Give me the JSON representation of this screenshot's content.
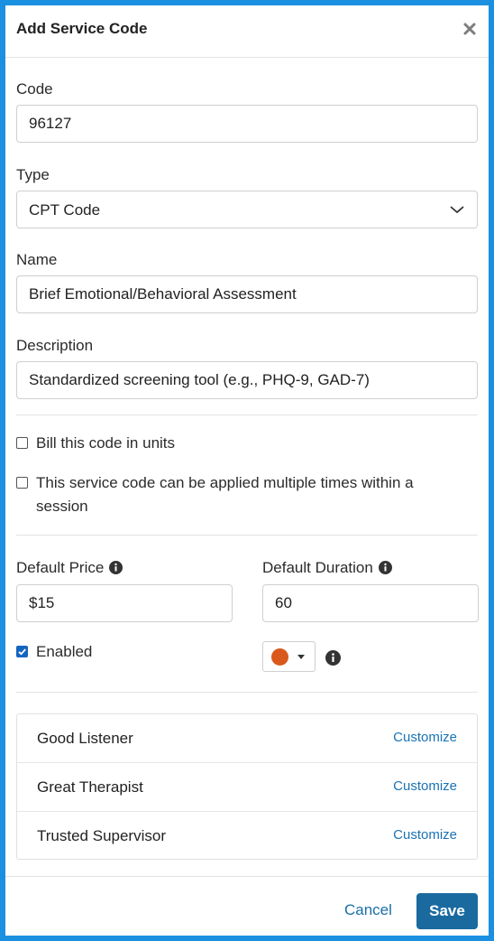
{
  "dialog": {
    "title": "Add Service Code",
    "close_icon": "close-icon"
  },
  "form": {
    "code": {
      "label": "Code",
      "value": "96127"
    },
    "type": {
      "label": "Type",
      "value": "CPT Code"
    },
    "name": {
      "label": "Name",
      "value": "Brief Emotional/Behavioral Assessment"
    },
    "description": {
      "label": "Description",
      "value": "Standardized screening tool (e.g., PHQ-9, GAD-7)"
    },
    "bill_units": {
      "label": "Bill this code in units",
      "checked": false
    },
    "multiple_times": {
      "label": "This service code can be applied multiple times within a session",
      "checked": false
    },
    "default_price": {
      "label": "Default Price",
      "value": "$15"
    },
    "default_duration": {
      "label": "Default Duration",
      "value": "60"
    },
    "enabled": {
      "label": "Enabled",
      "checked": true
    },
    "color": {
      "value": "#d9591c"
    }
  },
  "overrides": [
    {
      "name": "Good Listener",
      "action": "Customize"
    },
    {
      "name": "Great Therapist",
      "action": "Customize"
    },
    {
      "name": "Trusted Supervisor",
      "action": "Customize"
    }
  ],
  "footer": {
    "cancel_label": "Cancel",
    "save_label": "Save"
  },
  "colors": {
    "frame": "#1b8fe0",
    "link": "#1a73b5",
    "primary": "#1a6aa0",
    "checkbox": "#1565c0"
  }
}
